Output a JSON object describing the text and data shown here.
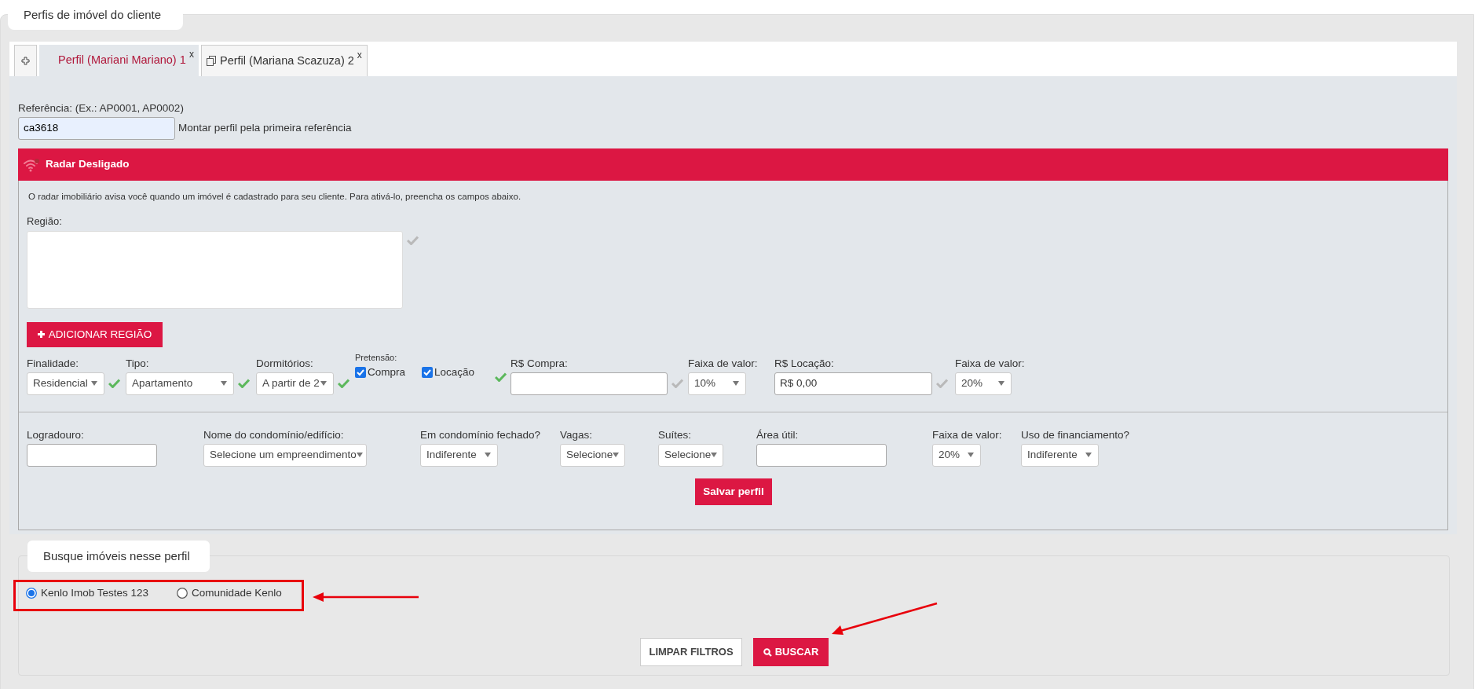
{
  "section_title": "Perfis de imóvel do cliente",
  "tabs": [
    {
      "kind": "add",
      "selected": false
    },
    {
      "kind": "profile",
      "label": "Perfil (Mariani Mariano) 1",
      "close": "x",
      "copy": false,
      "selected": true
    },
    {
      "kind": "profile",
      "label": "Perfil (Mariana Scazuza) 2",
      "close": "x",
      "copy": true,
      "selected": false
    }
  ],
  "reference": {
    "label": "Referência: (Ex.: AP0001, AP0002)",
    "value": "ca3618",
    "hint": "Montar perfil pela primeira referência"
  },
  "radar": {
    "title": "Radar Desligado",
    "on": false,
    "info": "O radar imobiliário avisa você quando um imóvel é cadastrado para seu cliente. Para ativá-lo, preencha os campos abaixo.",
    "region_label": "Região:",
    "region_valid": false,
    "add_region_button": "ADICIONAR REGIÃO"
  },
  "row1": [
    {
      "kind": "select",
      "label": "Finalidade:",
      "value": "Residencial",
      "valid": true
    },
    {
      "kind": "select",
      "label": "Tipo:",
      "value": "Apartamento",
      "valid": true
    },
    {
      "kind": "select",
      "label": "Dormitórios:",
      "value": "A partir de 2",
      "valid": true
    },
    {
      "kind": "checkgroup",
      "label": "Pretensão:",
      "options": [
        {
          "label": "Compra",
          "checked": true
        },
        {
          "label": "Locação",
          "checked": true
        }
      ],
      "valid": true
    },
    {
      "kind": "input",
      "label": "R$ Compra:",
      "valid": false
    },
    {
      "kind": "select",
      "label": "Faixa de valor:",
      "value": "10%"
    },
    {
      "kind": "input",
      "label": "R$ Locação:",
      "value": "R$ 0,00",
      "valid": false
    },
    {
      "kind": "select",
      "label": "Faixa de valor:",
      "value": "20%"
    }
  ],
  "row2": [
    {
      "kind": "input",
      "label": "Logradouro:"
    },
    {
      "kind": "select",
      "label": "Nome do condomínio/edifício:",
      "value": "Selecione um empreendimento"
    },
    {
      "kind": "select",
      "label": "Em condomínio fechado?",
      "value": "Indiferente"
    },
    {
      "kind": "select",
      "label": "Vagas:",
      "value": "Selecione"
    },
    {
      "kind": "select",
      "label": "Suítes:",
      "value": "Selecione"
    },
    {
      "kind": "input",
      "label": "Área útil:"
    },
    {
      "kind": "select",
      "label": "Faixa de valor:",
      "value": "20%"
    },
    {
      "kind": "select",
      "label": "Uso de financiamento?",
      "value": "Indiferente"
    }
  ],
  "save_button": "Salvar perfil",
  "search": {
    "title": "Busque imóveis nesse perfil",
    "sources": [
      {
        "label": "Kenlo Imob Testes 123",
        "selected": true
      },
      {
        "label": "Comunidade Kenlo",
        "selected": false
      }
    ],
    "buttons": [
      {
        "kind": "secondary",
        "label": "LIMPAR FILTROS"
      },
      {
        "kind": "primary",
        "label": "BUSCAR"
      }
    ]
  }
}
